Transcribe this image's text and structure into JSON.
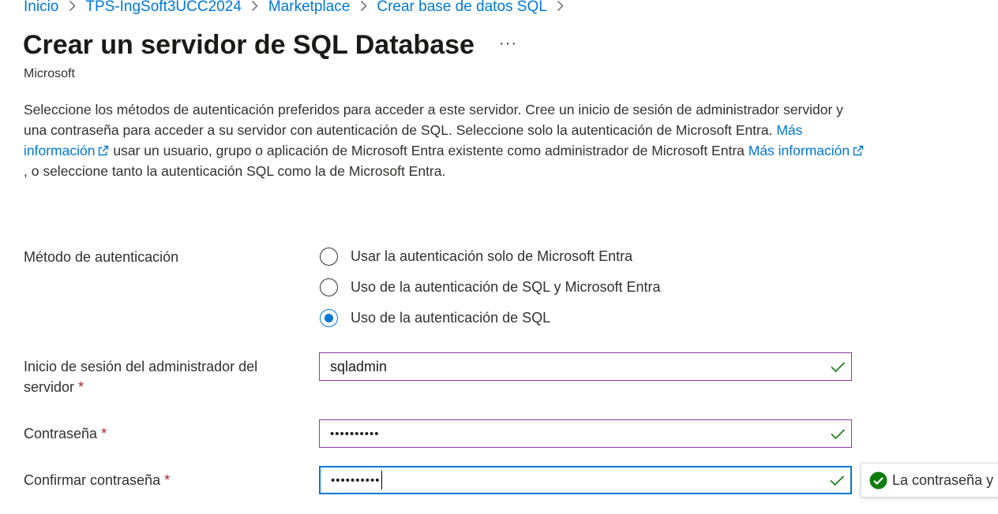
{
  "breadcrumb": {
    "items": [
      "Inicio",
      "TPS-IngSoft3UCC2024",
      "Marketplace",
      "Crear base de datos SQL"
    ],
    "separator": ">"
  },
  "page": {
    "title": "Crear un servidor de SQL Database",
    "more_label": "···",
    "publisher": "Microsoft"
  },
  "description": {
    "part1": "Seleccione los métodos de autenticación preferidos para acceder a este servidor. Cree un inicio de sesión de administrador servidor y una contraseña para acceder a su servidor con autenticación de SQL. Seleccione solo la autenticación de Microsoft Entra. ",
    "link1": "Más información",
    "part2": " usar un usuario, grupo o aplicación de Microsoft Entra existente como administrador de Microsoft Entra ",
    "link2": "Más información",
    "part3": " , o seleccione tanto la autenticación SQL como la de Microsoft Entra."
  },
  "auth": {
    "label": "Método de autenticación",
    "options": [
      {
        "label": "Usar la autenticación solo de Microsoft Entra",
        "checked": false
      },
      {
        "label": "Uso de la autenticación de SQL y Microsoft Entra",
        "checked": false
      },
      {
        "label": "Uso de la autenticación de SQL",
        "checked": true
      }
    ]
  },
  "form": {
    "admin_login": {
      "label": "Inicio de sesión del administrador del servidor",
      "required_mark": "*",
      "value": "sqladmin",
      "valid": true
    },
    "password": {
      "label": "Contraseña",
      "required_mark": "*",
      "value": "••••••••••",
      "valid": true
    },
    "confirm_password": {
      "label": "Confirmar contraseña",
      "required_mark": "*",
      "value": "••••••••••",
      "valid": true,
      "focused": true
    }
  },
  "tooltip": {
    "text": "La contraseña y"
  },
  "colors": {
    "link": "#0078d4",
    "valid": "#107c10",
    "required": "#a4262c",
    "field_border": "#8a3ba8",
    "focus_border": "#0078d4"
  },
  "icons": {
    "external_link": "external-link-icon",
    "check": "checkmark-icon",
    "success": "success-circle-icon"
  }
}
